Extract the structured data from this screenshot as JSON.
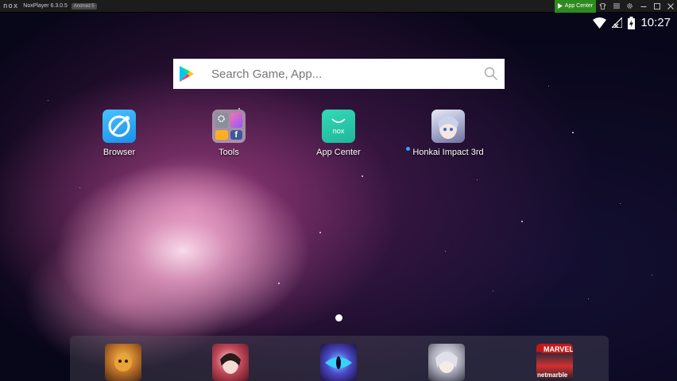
{
  "titlebar": {
    "logo_text": "nox",
    "app_title": "NoxPlayer 6.3.0.5",
    "android_badge": "Android 5",
    "app_center_label": "App Center"
  },
  "statusbar": {
    "time": "10:27"
  },
  "search": {
    "placeholder": "Search Game, App..."
  },
  "apps": [
    {
      "label": "Browser"
    },
    {
      "label": "Tools"
    },
    {
      "label": "App Center"
    },
    {
      "label": "Honkai Impact 3rd"
    }
  ],
  "dock": {
    "marvel_text": "MARVEL",
    "netmarble_text": "netmarble"
  }
}
